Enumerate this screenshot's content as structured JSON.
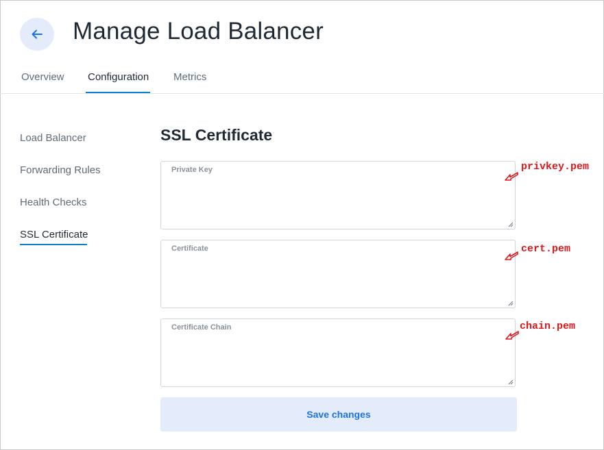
{
  "header": {
    "title": "Manage Load Balancer",
    "back_icon": "arrow-left-icon"
  },
  "tabs": [
    {
      "label": "Overview",
      "active": false
    },
    {
      "label": "Configuration",
      "active": true
    },
    {
      "label": "Metrics",
      "active": false
    }
  ],
  "sidebar": {
    "items": [
      {
        "label": "Load Balancer",
        "active": false
      },
      {
        "label": "Forwarding Rules",
        "active": false
      },
      {
        "label": "Health Checks",
        "active": false
      },
      {
        "label": "SSL Certificate",
        "active": true
      }
    ]
  },
  "section": {
    "title": "SSL Certificate"
  },
  "fields": [
    {
      "label": "Private Key",
      "value": ""
    },
    {
      "label": "Certificate",
      "value": ""
    },
    {
      "label": "Certificate Chain",
      "value": ""
    }
  ],
  "save_label": "Save changes",
  "annotations": [
    {
      "text": "privkey.pem"
    },
    {
      "text": "cert.pem"
    },
    {
      "text": "chain.pem"
    }
  ],
  "colors": {
    "accent": "#0b7fd3",
    "button_bg": "#e4ecfb",
    "button_text": "#1a73e8",
    "annotation": "#e0161a"
  }
}
